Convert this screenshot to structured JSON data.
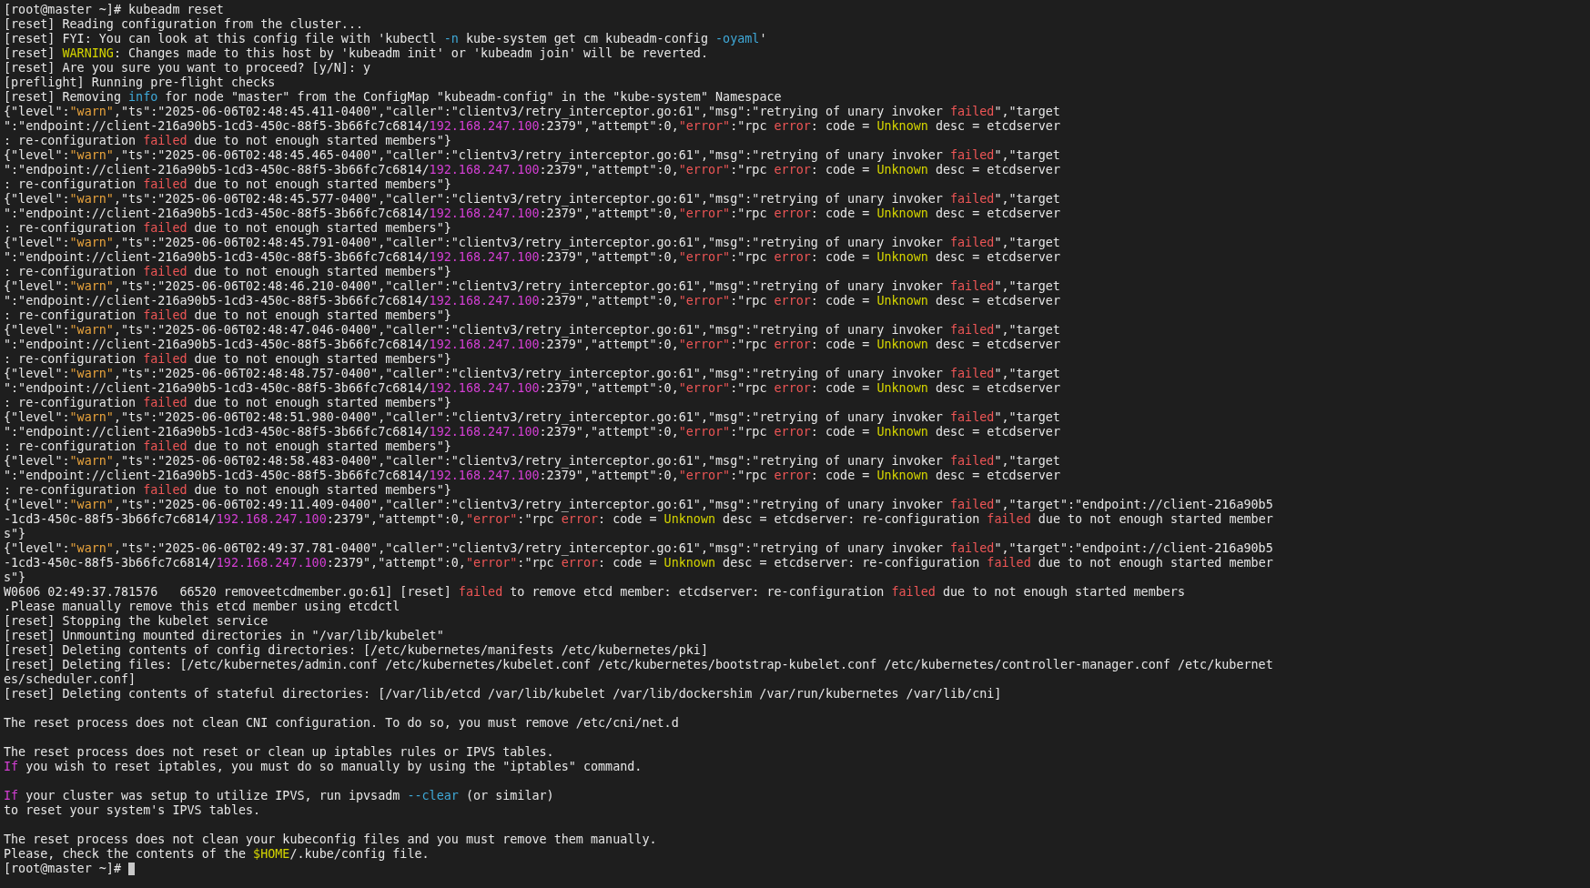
{
  "terminal": {
    "cursor": true,
    "blocks": [
      {
        "lines": [
          [
            {
              "kind": "plain",
              "text": "[root@master ~]# kubeadm reset"
            }
          ],
          [
            {
              "kind": "plain",
              "text": "[reset] Reading configuration from the cluster..."
            }
          ],
          [
            {
              "kind": "plain",
              "text": "[reset] FYI: You can look at this config file with 'kubectl "
            },
            {
              "kind": "option",
              "text": "-n"
            },
            {
              "kind": "plain",
              "text": " kube-system get cm kubeadm-config "
            },
            {
              "kind": "option",
              "text": "-oyaml"
            },
            {
              "kind": "plain",
              "text": "'"
            }
          ],
          [
            {
              "kind": "plain",
              "text": "[reset] "
            },
            {
              "kind": "highlight",
              "text": "WARNING"
            },
            {
              "kind": "plain",
              "text": ": Changes made to this host by 'kubeadm init' or 'kubeadm join' will be reverted."
            }
          ],
          [
            {
              "kind": "plain",
              "text": "[reset] Are you sure you want to proceed? [y/N]: y"
            }
          ],
          [
            {
              "kind": "plain",
              "text": "[preflight] Running pre-flight checks"
            }
          ],
          [
            {
              "kind": "plain",
              "text": "[reset] Removing "
            },
            {
              "kind": "option",
              "text": "info"
            },
            {
              "kind": "plain",
              "text": " for node \"master\" from the ConfigMap \"kubeadm-config\" in the \"kube-system\" Namespace"
            }
          ],
          [
            {
              "kind": "plain",
              "text": "{\"level\":"
            },
            {
              "kind": "warn",
              "text": "\"warn\""
            },
            {
              "kind": "plain",
              "text": ",\"ts\":\"2025-06-06T02:48:45.411-0400\",\"caller\":\"clientv3/retry_interceptor.go:61\",\"msg\":\"retrying of unary invoker "
            },
            {
              "kind": "error",
              "text": "failed"
            },
            {
              "kind": "plain",
              "text": "\",\"target"
            }
          ],
          [
            {
              "kind": "plain",
              "text": "\":\"endpoint://client-216a90b5-1cd3-450c-88f5-3b66fc7c6814/"
            },
            {
              "kind": "address",
              "text": "192.168.247.100"
            },
            {
              "kind": "plain",
              "text": ":2379\",\"attempt\":0,"
            },
            {
              "kind": "error",
              "text": "\"error\""
            },
            {
              "kind": "plain",
              "text": ":\"rpc "
            },
            {
              "kind": "error",
              "text": "error"
            },
            {
              "kind": "plain",
              "text": ": code = "
            },
            {
              "kind": "highlight",
              "text": "Unknown"
            },
            {
              "kind": "plain",
              "text": " desc = etcdserver"
            }
          ],
          [
            {
              "kind": "plain",
              "text": ": re-configuration "
            },
            {
              "kind": "error",
              "text": "failed"
            },
            {
              "kind": "plain",
              "text": " due to not enough started members\"}"
            }
          ],
          [
            {
              "kind": "plain",
              "text": "{\"level\":"
            },
            {
              "kind": "warn",
              "text": "\"warn\""
            },
            {
              "kind": "plain",
              "text": ",\"ts\":\"2025-06-06T02:48:45.465-0400\",\"caller\":\"clientv3/retry_interceptor.go:61\",\"msg\":\"retrying of unary invoker "
            },
            {
              "kind": "error",
              "text": "failed"
            },
            {
              "kind": "plain",
              "text": "\",\"target"
            }
          ],
          [
            {
              "kind": "plain",
              "text": "\":\"endpoint://client-216a90b5-1cd3-450c-88f5-3b66fc7c6814/"
            },
            {
              "kind": "address",
              "text": "192.168.247.100"
            },
            {
              "kind": "plain",
              "text": ":2379\",\"attempt\":0,"
            },
            {
              "kind": "error",
              "text": "\"error\""
            },
            {
              "kind": "plain",
              "text": ":\"rpc "
            },
            {
              "kind": "error",
              "text": "error"
            },
            {
              "kind": "plain",
              "text": ": code = "
            },
            {
              "kind": "highlight",
              "text": "Unknown"
            },
            {
              "kind": "plain",
              "text": " desc = etcdserver"
            }
          ],
          [
            {
              "kind": "plain",
              "text": ": re-configuration "
            },
            {
              "kind": "error",
              "text": "failed"
            },
            {
              "kind": "plain",
              "text": " due to not enough started members\"}"
            }
          ],
          [
            {
              "kind": "plain",
              "text": "{\"level\":"
            },
            {
              "kind": "warn",
              "text": "\"warn\""
            },
            {
              "kind": "plain",
              "text": ",\"ts\":\"2025-06-06T02:48:45.577-0400\",\"caller\":\"clientv3/retry_interceptor.go:61\",\"msg\":\"retrying of unary invoker "
            },
            {
              "kind": "error",
              "text": "failed"
            },
            {
              "kind": "plain",
              "text": "\",\"target"
            }
          ],
          [
            {
              "kind": "plain",
              "text": "\":\"endpoint://client-216a90b5-1cd3-450c-88f5-3b66fc7c6814/"
            },
            {
              "kind": "address",
              "text": "192.168.247.100"
            },
            {
              "kind": "plain",
              "text": ":2379\",\"attempt\":0,"
            },
            {
              "kind": "error",
              "text": "\"error\""
            },
            {
              "kind": "plain",
              "text": ":\"rpc "
            },
            {
              "kind": "error",
              "text": "error"
            },
            {
              "kind": "plain",
              "text": ": code = "
            },
            {
              "kind": "highlight",
              "text": "Unknown"
            },
            {
              "kind": "plain",
              "text": " desc = etcdserver"
            }
          ],
          [
            {
              "kind": "plain",
              "text": ": re-configuration "
            },
            {
              "kind": "error",
              "text": "failed"
            },
            {
              "kind": "plain",
              "text": " due to not enough started members\"}"
            }
          ],
          [
            {
              "kind": "plain",
              "text": "{\"level\":"
            },
            {
              "kind": "warn",
              "text": "\"warn\""
            },
            {
              "kind": "plain",
              "text": ",\"ts\":\"2025-06-06T02:48:45.791-0400\",\"caller\":\"clientv3/retry_interceptor.go:61\",\"msg\":\"retrying of unary invoker "
            },
            {
              "kind": "error",
              "text": "failed"
            },
            {
              "kind": "plain",
              "text": "\",\"target"
            }
          ],
          [
            {
              "kind": "plain",
              "text": "\":\"endpoint://client-216a90b5-1cd3-450c-88f5-3b66fc7c6814/"
            },
            {
              "kind": "address",
              "text": "192.168.247.100"
            },
            {
              "kind": "plain",
              "text": ":2379\",\"attempt\":0,"
            },
            {
              "kind": "error",
              "text": "\"error\""
            },
            {
              "kind": "plain",
              "text": ":\"rpc "
            },
            {
              "kind": "error",
              "text": "error"
            },
            {
              "kind": "plain",
              "text": ": code = "
            },
            {
              "kind": "highlight",
              "text": "Unknown"
            },
            {
              "kind": "plain",
              "text": " desc = etcdserver"
            }
          ],
          [
            {
              "kind": "plain",
              "text": ": re-configuration "
            },
            {
              "kind": "error",
              "text": "failed"
            },
            {
              "kind": "plain",
              "text": " due to not enough started members\"}"
            }
          ],
          [
            {
              "kind": "plain",
              "text": "{\"level\":"
            },
            {
              "kind": "warn",
              "text": "\"warn\""
            },
            {
              "kind": "plain",
              "text": ",\"ts\":\"2025-06-06T02:48:46.210-0400\",\"caller\":\"clientv3/retry_interceptor.go:61\",\"msg\":\"retrying of unary invoker "
            },
            {
              "kind": "error",
              "text": "failed"
            },
            {
              "kind": "plain",
              "text": "\",\"target"
            }
          ],
          [
            {
              "kind": "plain",
              "text": "\":\"endpoint://client-216a90b5-1cd3-450c-88f5-3b66fc7c6814/"
            },
            {
              "kind": "address",
              "text": "192.168.247.100"
            },
            {
              "kind": "plain",
              "text": ":2379\",\"attempt\":0,"
            },
            {
              "kind": "error",
              "text": "\"error\""
            },
            {
              "kind": "plain",
              "text": ":\"rpc "
            },
            {
              "kind": "error",
              "text": "error"
            },
            {
              "kind": "plain",
              "text": ": code = "
            },
            {
              "kind": "highlight",
              "text": "Unknown"
            },
            {
              "kind": "plain",
              "text": " desc = etcdserver"
            }
          ],
          [
            {
              "kind": "plain",
              "text": ": re-configuration "
            },
            {
              "kind": "error",
              "text": "failed"
            },
            {
              "kind": "plain",
              "text": " due to not enough started members\"}"
            }
          ],
          [
            {
              "kind": "plain",
              "text": "{\"level\":"
            },
            {
              "kind": "warn",
              "text": "\"warn\""
            },
            {
              "kind": "plain",
              "text": ",\"ts\":\"2025-06-06T02:48:47.046-0400\",\"caller\":\"clientv3/retry_interceptor.go:61\",\"msg\":\"retrying of unary invoker "
            },
            {
              "kind": "error",
              "text": "failed"
            },
            {
              "kind": "plain",
              "text": "\",\"target"
            }
          ],
          [
            {
              "kind": "plain",
              "text": "\":\"endpoint://client-216a90b5-1cd3-450c-88f5-3b66fc7c6814/"
            },
            {
              "kind": "address",
              "text": "192.168.247.100"
            },
            {
              "kind": "plain",
              "text": ":2379\",\"attempt\":0,"
            },
            {
              "kind": "error",
              "text": "\"error\""
            },
            {
              "kind": "plain",
              "text": ":\"rpc "
            },
            {
              "kind": "error",
              "text": "error"
            },
            {
              "kind": "plain",
              "text": ": code = "
            },
            {
              "kind": "highlight",
              "text": "Unknown"
            },
            {
              "kind": "plain",
              "text": " desc = etcdserver"
            }
          ],
          [
            {
              "kind": "plain",
              "text": ": re-configuration "
            },
            {
              "kind": "error",
              "text": "failed"
            },
            {
              "kind": "plain",
              "text": " due to not enough started members\"}"
            }
          ],
          [
            {
              "kind": "plain",
              "text": "{\"level\":"
            },
            {
              "kind": "warn",
              "text": "\"warn\""
            },
            {
              "kind": "plain",
              "text": ",\"ts\":\"2025-06-06T02:48:48.757-0400\",\"caller\":\"clientv3/retry_interceptor.go:61\",\"msg\":\"retrying of unary invoker "
            },
            {
              "kind": "error",
              "text": "failed"
            },
            {
              "kind": "plain",
              "text": "\",\"target"
            }
          ],
          [
            {
              "kind": "plain",
              "text": "\":\"endpoint://client-216a90b5-1cd3-450c-88f5-3b66fc7c6814/"
            },
            {
              "kind": "address",
              "text": "192.168.247.100"
            },
            {
              "kind": "plain",
              "text": ":2379\",\"attempt\":0,"
            },
            {
              "kind": "error",
              "text": "\"error\""
            },
            {
              "kind": "plain",
              "text": ":\"rpc "
            },
            {
              "kind": "error",
              "text": "error"
            },
            {
              "kind": "plain",
              "text": ": code = "
            },
            {
              "kind": "highlight",
              "text": "Unknown"
            },
            {
              "kind": "plain",
              "text": " desc = etcdserver"
            }
          ],
          [
            {
              "kind": "plain",
              "text": ": re-configuration "
            },
            {
              "kind": "error",
              "text": "failed"
            },
            {
              "kind": "plain",
              "text": " due to not enough started members\"}"
            }
          ],
          [
            {
              "kind": "plain",
              "text": "{\"level\":"
            },
            {
              "kind": "warn",
              "text": "\"warn\""
            },
            {
              "kind": "plain",
              "text": ",\"ts\":\"2025-06-06T02:48:51.980-0400\",\"caller\":\"clientv3/retry_interceptor.go:61\",\"msg\":\"retrying of unary invoker "
            },
            {
              "kind": "error",
              "text": "failed"
            },
            {
              "kind": "plain",
              "text": "\",\"target"
            }
          ],
          [
            {
              "kind": "plain",
              "text": "\":\"endpoint://client-216a90b5-1cd3-450c-88f5-3b66fc7c6814/"
            },
            {
              "kind": "address",
              "text": "192.168.247.100"
            },
            {
              "kind": "plain",
              "text": ":2379\",\"attempt\":0,"
            },
            {
              "kind": "error",
              "text": "\"error\""
            },
            {
              "kind": "plain",
              "text": ":\"rpc "
            },
            {
              "kind": "error",
              "text": "error"
            },
            {
              "kind": "plain",
              "text": ": code = "
            },
            {
              "kind": "highlight",
              "text": "Unknown"
            },
            {
              "kind": "plain",
              "text": " desc = etcdserver"
            }
          ],
          [
            {
              "kind": "plain",
              "text": ": re-configuration "
            },
            {
              "kind": "error",
              "text": "failed"
            },
            {
              "kind": "plain",
              "text": " due to not enough started members\"}"
            }
          ],
          [
            {
              "kind": "plain",
              "text": "{\"level\":"
            },
            {
              "kind": "warn",
              "text": "\"warn\""
            },
            {
              "kind": "plain",
              "text": ",\"ts\":\"2025-06-06T02:48:58.483-0400\",\"caller\":\"clientv3/retry_interceptor.go:61\",\"msg\":\"retrying of unary invoker "
            },
            {
              "kind": "error",
              "text": "failed"
            },
            {
              "kind": "plain",
              "text": "\",\"target"
            }
          ],
          [
            {
              "kind": "plain",
              "text": "\":\"endpoint://client-216a90b5-1cd3-450c-88f5-3b66fc7c6814/"
            },
            {
              "kind": "address",
              "text": "192.168.247.100"
            },
            {
              "kind": "plain",
              "text": ":2379\",\"attempt\":0,"
            },
            {
              "kind": "error",
              "text": "\"error\""
            },
            {
              "kind": "plain",
              "text": ":\"rpc "
            },
            {
              "kind": "error",
              "text": "error"
            },
            {
              "kind": "plain",
              "text": ": code = "
            },
            {
              "kind": "highlight",
              "text": "Unknown"
            },
            {
              "kind": "plain",
              "text": " desc = etcdserver"
            }
          ],
          [
            {
              "kind": "plain",
              "text": ": re-configuration "
            },
            {
              "kind": "error",
              "text": "failed"
            },
            {
              "kind": "plain",
              "text": " due to not enough started members\"}"
            }
          ],
          [
            {
              "kind": "plain",
              "text": "{\"level\":"
            },
            {
              "kind": "warn",
              "text": "\"warn\""
            },
            {
              "kind": "plain",
              "text": ",\"ts\":\"2025-06-06T02:49:11.409-0400\",\"caller\":\"clientv3/retry_interceptor.go:61\",\"msg\":\"retrying of unary invoker "
            },
            {
              "kind": "error",
              "text": "failed"
            },
            {
              "kind": "plain",
              "text": "\",\"target\":\"endpoint://client-216a90b5"
            }
          ],
          [
            {
              "kind": "plain",
              "text": "-1cd3-450c-88f5-3b66fc7c6814/"
            },
            {
              "kind": "address",
              "text": "192.168.247.100"
            },
            {
              "kind": "plain",
              "text": ":2379\",\"attempt\":0,"
            },
            {
              "kind": "error",
              "text": "\"error\""
            },
            {
              "kind": "plain",
              "text": ":\"rpc "
            },
            {
              "kind": "error",
              "text": "error"
            },
            {
              "kind": "plain",
              "text": ": code = "
            },
            {
              "kind": "highlight",
              "text": "Unknown"
            },
            {
              "kind": "plain",
              "text": " desc = etcdserver: re-configuration "
            },
            {
              "kind": "error",
              "text": "failed"
            },
            {
              "kind": "plain",
              "text": " due to not enough started member"
            }
          ],
          [
            {
              "kind": "plain",
              "text": "s\"}"
            }
          ],
          [
            {
              "kind": "plain",
              "text": "{\"level\":"
            },
            {
              "kind": "warn",
              "text": "\"warn\""
            },
            {
              "kind": "plain",
              "text": ",\"ts\":\"2025-06-06T02:49:37.781-0400\",\"caller\":\"clientv3/retry_interceptor.go:61\",\"msg\":\"retrying of unary invoker "
            },
            {
              "kind": "error",
              "text": "failed"
            },
            {
              "kind": "plain",
              "text": "\",\"target\":\"endpoint://client-216a90b5"
            }
          ],
          [
            {
              "kind": "plain",
              "text": "-1cd3-450c-88f5-3b66fc7c6814/"
            },
            {
              "kind": "address",
              "text": "192.168.247.100"
            },
            {
              "kind": "plain",
              "text": ":2379\",\"attempt\":0,"
            },
            {
              "kind": "error",
              "text": "\"error\""
            },
            {
              "kind": "plain",
              "text": ":\"rpc "
            },
            {
              "kind": "error",
              "text": "error"
            },
            {
              "kind": "plain",
              "text": ": code = "
            },
            {
              "kind": "highlight",
              "text": "Unknown"
            },
            {
              "kind": "plain",
              "text": " desc = etcdserver: re-configuration "
            },
            {
              "kind": "error",
              "text": "failed"
            },
            {
              "kind": "plain",
              "text": " due to not enough started member"
            }
          ],
          [
            {
              "kind": "plain",
              "text": "s\"}"
            }
          ],
          [
            {
              "kind": "plain",
              "text": "W0606 02:49:37.781576   66520 removeetcdmember.go:61] [reset] "
            },
            {
              "kind": "error",
              "text": "failed"
            },
            {
              "kind": "plain",
              "text": " to remove etcd member: etcdserver: re-configuration "
            },
            {
              "kind": "error",
              "text": "failed"
            },
            {
              "kind": "plain",
              "text": " due to not enough started members"
            }
          ],
          [
            {
              "kind": "plain",
              "text": ".Please manually remove this etcd member using etcdctl"
            }
          ],
          [
            {
              "kind": "plain",
              "text": "[reset] Stopping the kubelet service"
            }
          ],
          [
            {
              "kind": "plain",
              "text": "[reset] Unmounting mounted directories in \"/var/lib/kubelet\""
            }
          ],
          [
            {
              "kind": "plain",
              "text": "[reset] Deleting contents of config directories: [/etc/kubernetes/manifests /etc/kubernetes/pki]"
            }
          ],
          [
            {
              "kind": "plain",
              "text": "[reset] Deleting files: [/etc/kubernetes/admin.conf /etc/kubernetes/kubelet.conf /etc/kubernetes/bootstrap-kubelet.conf /etc/kubernetes/controller-manager.conf /etc/kubernet"
            }
          ],
          [
            {
              "kind": "plain",
              "text": "es/scheduler.conf]"
            }
          ],
          [
            {
              "kind": "plain",
              "text": "[reset] Deleting contents of stateful directories: [/var/lib/etcd /var/lib/kubelet /var/lib/dockershim /var/run/kubernetes /var/lib/cni]"
            }
          ]
        ]
      },
      {
        "lines": [
          [
            {
              "kind": "plain",
              "text": "The reset process does not clean CNI configuration. To do so, you must remove /etc/cni/net.d"
            }
          ]
        ]
      },
      {
        "lines": [
          [
            {
              "kind": "plain",
              "text": "The reset process does not reset or clean up iptables rules or IPVS tables."
            }
          ],
          [
            {
              "kind": "keyword",
              "text": "If"
            },
            {
              "kind": "plain",
              "text": " you wish to reset iptables, you must do so manually by using the \"iptables\" command."
            }
          ]
        ]
      },
      {
        "lines": [
          [
            {
              "kind": "keyword",
              "text": "If"
            },
            {
              "kind": "plain",
              "text": " your cluster was setup to utilize IPVS, run ipvsadm "
            },
            {
              "kind": "option",
              "text": "--clear"
            },
            {
              "kind": "plain",
              "text": " (or similar)"
            }
          ],
          [
            {
              "kind": "plain",
              "text": "to reset your system's IPVS tables."
            }
          ]
        ]
      },
      {
        "lines": [
          [
            {
              "kind": "plain",
              "text": "The reset process does not clean your kubeconfig files and you must remove them manually."
            }
          ],
          [
            {
              "kind": "plain",
              "text": "Please, check the contents of the "
            },
            {
              "kind": "highlight",
              "text": "$HOME"
            },
            {
              "kind": "plain",
              "text": "/.kube/config file."
            }
          ],
          [
            {
              "kind": "plain",
              "text": "[root@master ~]# "
            }
          ]
        ]
      }
    ]
  }
}
